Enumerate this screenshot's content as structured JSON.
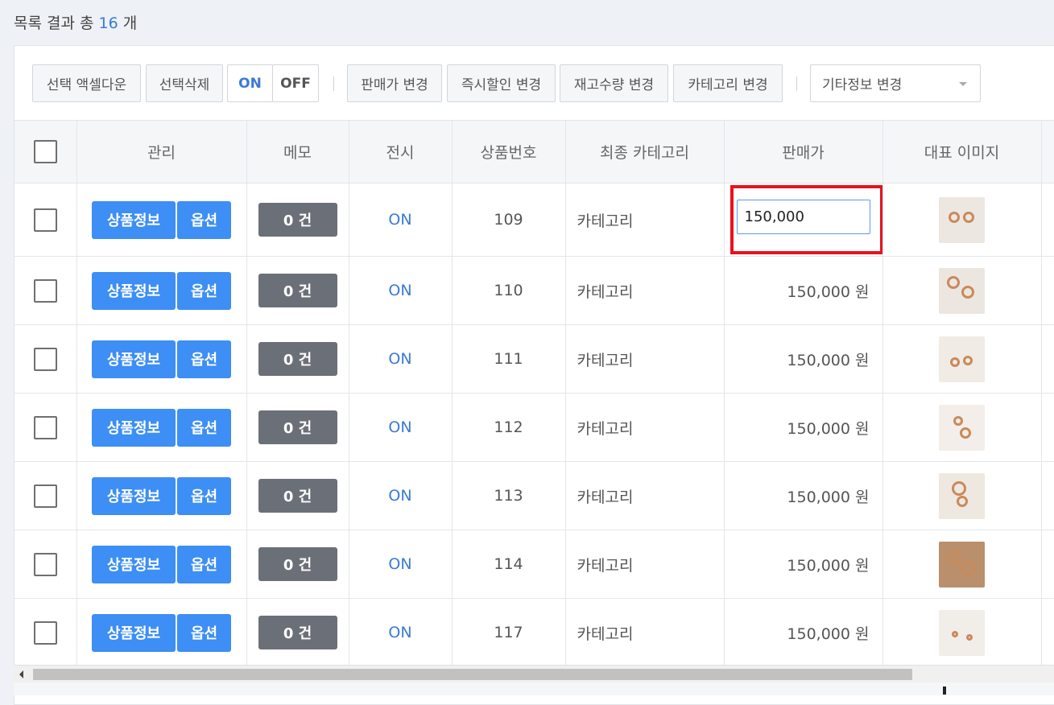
{
  "summary": {
    "label": "목록 결과 총",
    "count": "16",
    "unit": "개"
  },
  "toolbar": {
    "excel_download": "선택 액셀다운",
    "delete_selected": "선택삭제",
    "on": "ON",
    "off": "OFF",
    "price_change": "판매가 변경",
    "instant_discount_change": "즉시할인 변경",
    "stock_change": "재고수량 변경",
    "category_change": "카테고리 변경",
    "other_info_select": "기타정보 변경"
  },
  "table": {
    "headers": {
      "manage": "관리",
      "memo": "메모",
      "display": "전시",
      "product_no": "상품번호",
      "final_category": "최종 카테고리",
      "price": "판매가",
      "main_image": "대표 이미지"
    },
    "buttons": {
      "product_info": "상품정보",
      "option": "옵션"
    },
    "editing_price_value": "150,000",
    "rows": [
      {
        "memo": "0 건",
        "display": "ON",
        "product_no": "109",
        "category": "카테고리",
        "price": "150,000 원"
      },
      {
        "memo": "0 건",
        "display": "ON",
        "product_no": "110",
        "category": "카테고리",
        "price": "150,000 원"
      },
      {
        "memo": "0 건",
        "display": "ON",
        "product_no": "111",
        "category": "카테고리",
        "price": "150,000 원"
      },
      {
        "memo": "0 건",
        "display": "ON",
        "product_no": "112",
        "category": "카테고리",
        "price": "150,000 원"
      },
      {
        "memo": "0 건",
        "display": "ON",
        "product_no": "113",
        "category": "카테고리",
        "price": "150,000 원"
      },
      {
        "memo": "0 건",
        "display": "ON",
        "product_no": "114",
        "category": "카테고리",
        "price": "150,000 원"
      },
      {
        "memo": "0 건",
        "display": "ON",
        "product_no": "117",
        "category": "카테고리",
        "price": "150,000 원"
      }
    ]
  },
  "colors": {
    "accent_blue": "#3d8ef5",
    "on_text": "#3b7ad6",
    "memo_badge": "#6b6f78",
    "highlight_red": "#e8121e"
  }
}
